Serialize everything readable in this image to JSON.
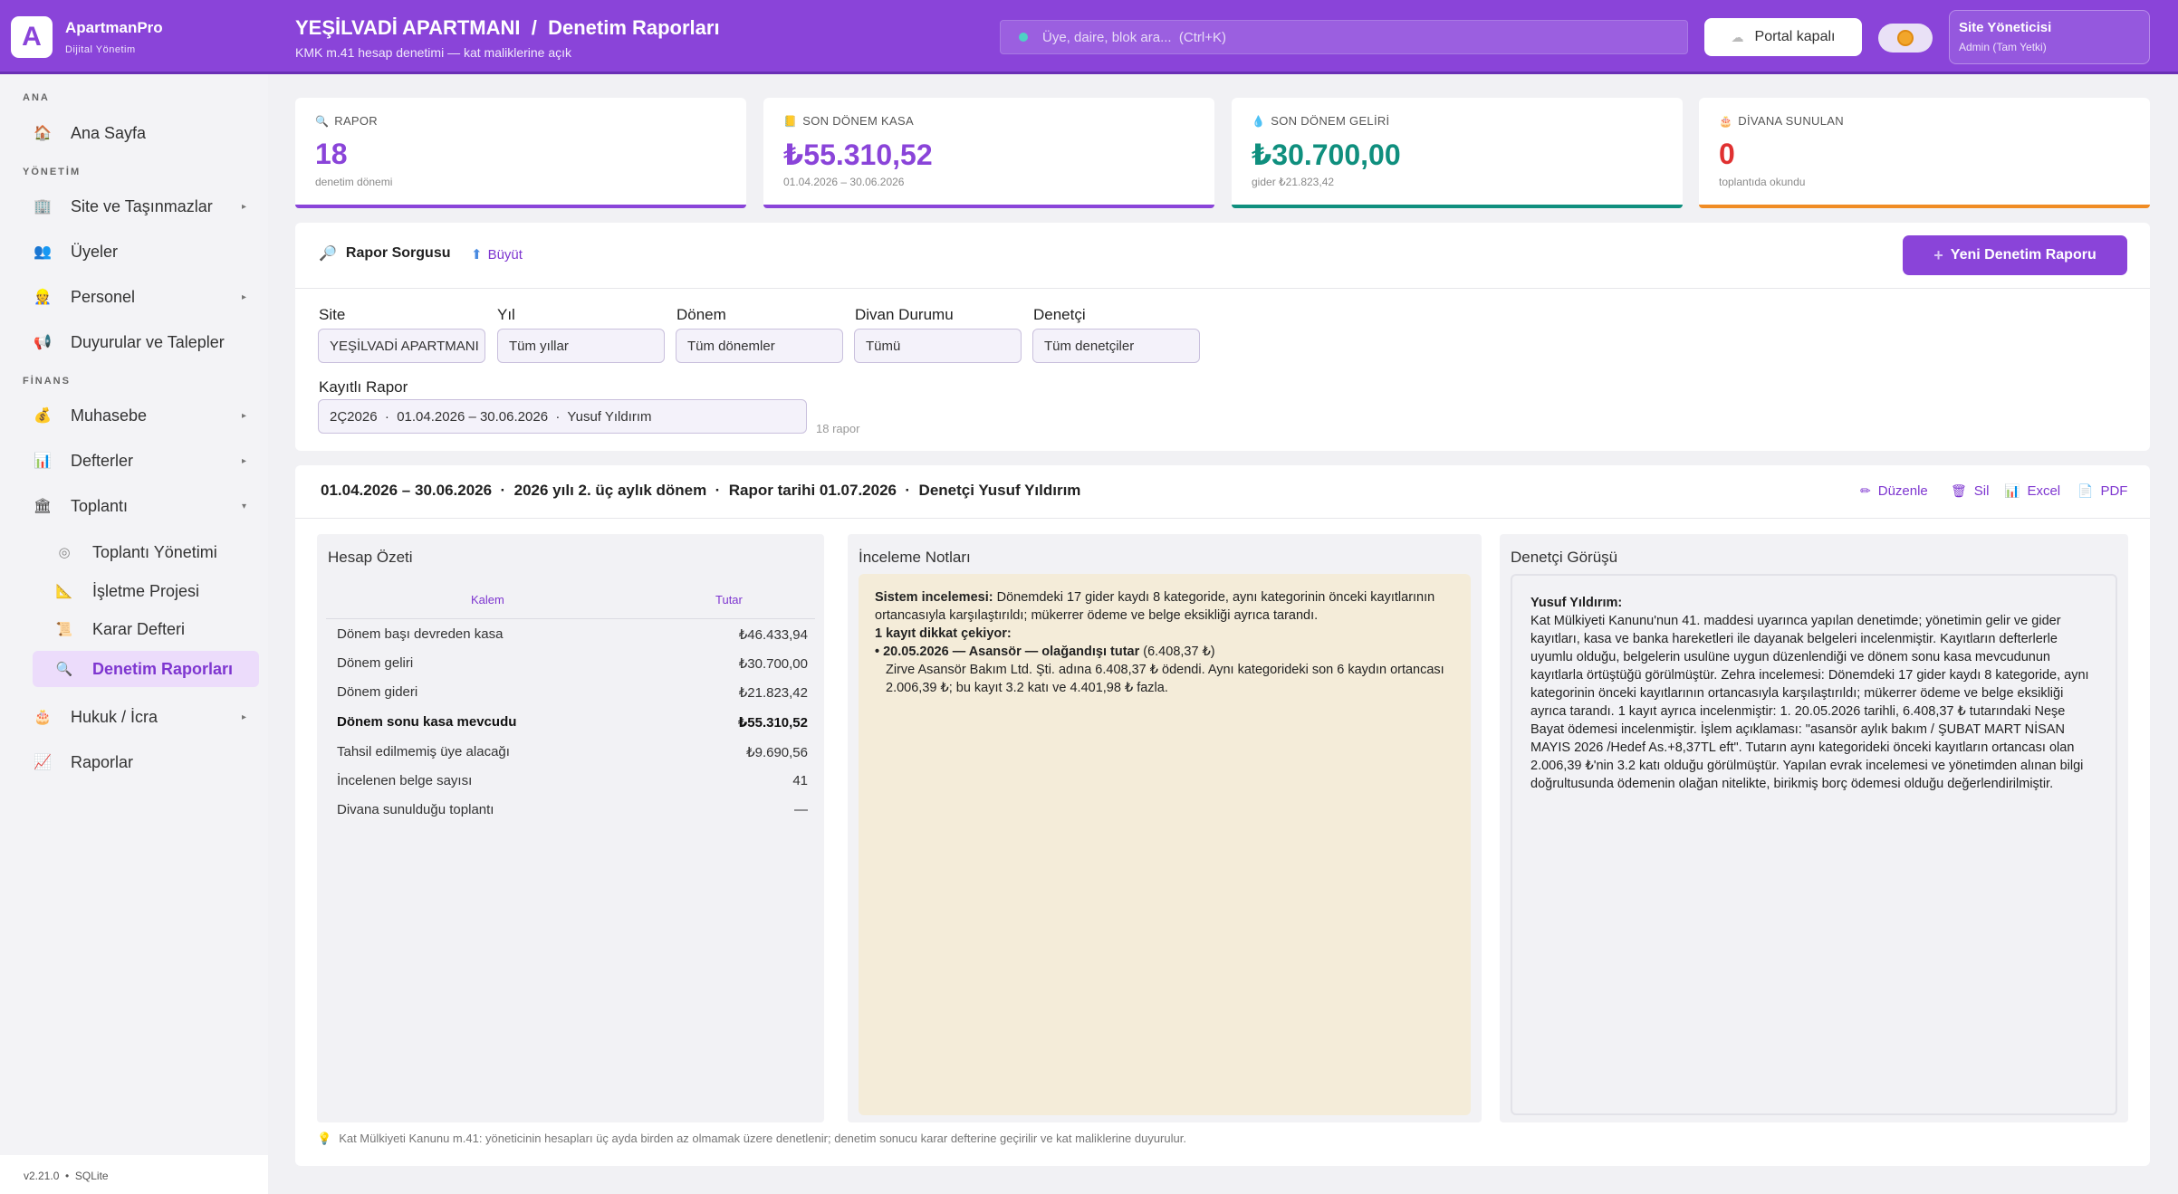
{
  "brand": {
    "name": "ApartmanPro",
    "subtitle": "Dijital Yönetim",
    "logo_letter": "A"
  },
  "header": {
    "title": "YEŞİLVADİ APARTMANI  /  Denetim Raporları",
    "subtitle": "KMK m.41 hesap denetimi — kat maliklerine açık"
  },
  "search": {
    "placeholder": "Üye, daire, blok ara...  (Ctrl+K)"
  },
  "portal_label": "Portal kapalı",
  "user": {
    "name": "Site Yöneticisi",
    "role": "Admin (Tam Yetki)"
  },
  "sidebar": {
    "sections": {
      "ana": "ANA",
      "yonetim": "YÖNETİM",
      "finans": "FİNANS"
    },
    "items": {
      "home": "Ana Sayfa",
      "site": "Site ve Taşınmazlar",
      "members": "Üyeler",
      "staff": "Personel",
      "announcements": "Duyurular ve Talepler",
      "accounting": "Muhasebe",
      "books": "Defterler",
      "meeting": "Toplantı",
      "meeting_mgmt": "Toplantı Yönetimi",
      "operation": "İşletme Projesi",
      "decisions": "Karar Defteri",
      "audit": "Denetim Raporları",
      "legal": "Hukuk / İcra",
      "reports": "Raporlar"
    },
    "version": "v2.21.0  •  SQLite"
  },
  "kpis": [
    {
      "label": "RAPOR",
      "value": "18",
      "hint": "denetim dönemi",
      "color": "#8a44d9",
      "icon": "search-icon"
    },
    {
      "label": "SON DÖNEM KASA",
      "value": "₺55.310,52",
      "hint": "01.04.2026 – 30.06.2026",
      "color": "#8a44d9",
      "icon": "ledger-icon"
    },
    {
      "label": "SON DÖNEM GELİRİ",
      "value": "₺30.700,00",
      "hint": "gider ₺21.823,42",
      "color": "#0f8f7e",
      "icon": "income-icon"
    },
    {
      "label": "DİVANA SUNULAN",
      "value": "0",
      "hint": "toplantıda okundu",
      "color": "#e03131",
      "icon": "cake-icon"
    }
  ],
  "kpi_bar_colors": [
    "#8a44d9",
    "#8a44d9",
    "#0f8f7e",
    "#f08c24"
  ],
  "query": {
    "title": "Rapor Sorgusu",
    "expand": "Büyüt",
    "new_button": "Yeni Denetim Raporu",
    "fields": {
      "site": {
        "label": "Site",
        "value": "YEŞİLVADİ APARTMANI"
      },
      "year": {
        "label": "Yıl",
        "value": "Tüm yıllar"
      },
      "period": {
        "label": "Dönem",
        "value": "Tüm dönemler"
      },
      "divan": {
        "label": "Divan Durumu",
        "value": "Tümü"
      },
      "auditor": {
        "label": "Denetçi",
        "value": "Tüm denetçiler"
      },
      "saved": {
        "label": "Kayıtlı Rapor",
        "value": "2Ç2026  ·  01.04.2026 – 30.06.2026  ·  Yusuf Yıldırım"
      }
    },
    "count": "18 rapor"
  },
  "report": {
    "header": "01.04.2026 – 30.06.2026  ·  2026 yılı 2. üç aylık dönem  ·  Rapor tarihi 01.07.2026  ·  Denetçi Yusuf Yıldırım",
    "actions": {
      "edit": "Düzenle",
      "delete": "Sil",
      "excel": "Excel",
      "pdf": "PDF"
    },
    "summary": {
      "title": "Hesap Özeti",
      "col_item": "Kalem",
      "col_amount": "Tutar",
      "rows": [
        {
          "k": "Dönem başı devreden kasa",
          "v": "₺46.433,94"
        },
        {
          "k": "Dönem geliri",
          "v": "₺30.700,00"
        },
        {
          "k": "Dönem gideri",
          "v": "₺21.823,42"
        },
        {
          "k": "Dönem sonu kasa mevcudu",
          "v": "₺55.310,52"
        },
        {
          "k": "Tahsil edilmemiş üye alacağı",
          "v": "₺9.690,56"
        },
        {
          "k": "İncelenen belge sayısı",
          "v": "41"
        },
        {
          "k": "Divana sunulduğu toplantı",
          "v": "—"
        }
      ]
    },
    "notes": {
      "title": "İnceleme Notları",
      "label_system": "Sistem incelemesi:",
      "system_text": " Dönemdeki 17 gider kaydı 8 kategoride, aynı kategorinin önceki kayıtlarının ortancasıyla karşılaştırıldı; mükerrer ödeme ve belge eksikliği ayrıca tarandı.",
      "attention": "1 kayıt dikkat çekiyor:",
      "item_title": "• 20.05.2026 — Asansör — olağandışı tutar",
      "item_amount": " (6.408,37 ₺)",
      "item_detail": "Zirve Asansör Bakım Ltd. Şti. adına 6.408,37 ₺ ödendi. Aynı kategorideki son 6 kaydın ortancası 2.006,39 ₺; bu kayıt 3.2 katı ve 4.401,98 ₺ fazla."
    },
    "opinion": {
      "title": "Denetçi Görüşü",
      "author": "Yusuf Yıldırım:",
      "text": "Kat Mülkiyeti Kanunu'nun 41. maddesi uyarınca yapılan denetimde; yönetimin gelir ve gider kayıtları, kasa ve banka hareketleri ile dayanak belgeleri incelenmiştir. Kayıtların defterlerle uyumlu olduğu, belgelerin usulüne uygun düzenlendiği ve dönem sonu kasa mevcudunun kayıtlarla örtüştüğü görülmüştür. Zehra incelemesi: Dönemdeki 17 gider kaydı 8 kategoride, aynı kategorinin önceki kayıtlarının ortancasıyla karşılaştırıldı; mükerrer ödeme ve belge eksikliği ayrıca tarandı. 1 kayıt ayrıca incelenmiştir: 1. 20.05.2026 tarihli, 6.408,37 ₺ tutarındaki Neşe Bayat ödemesi incelenmiştir. İşlem açıklaması: \"asansör aylık bakım / ŞUBAT MART NİSAN MAYIS 2026 /Hedef As.+8,37TL eft\". Tutarın aynı kategorideki önceki kayıtların ortancası olan 2.006,39 ₺'nin 3.2 katı olduğu görülmüştür. Yapılan evrak incelemesi ve yönetimden alınan bilgi doğrultusunda ödemenin olağan nitelikte, birikmiş borç ödemesi olduğu değerlendirilmiştir."
    }
  },
  "footnote": "Kat Mülkiyeti Kanunu m.41: yöneticinin hesapları üç ayda birden az olmamak üzere denetlenir; denetim sonucu karar defterine geçirilir ve kat maliklerine duyurulur."
}
